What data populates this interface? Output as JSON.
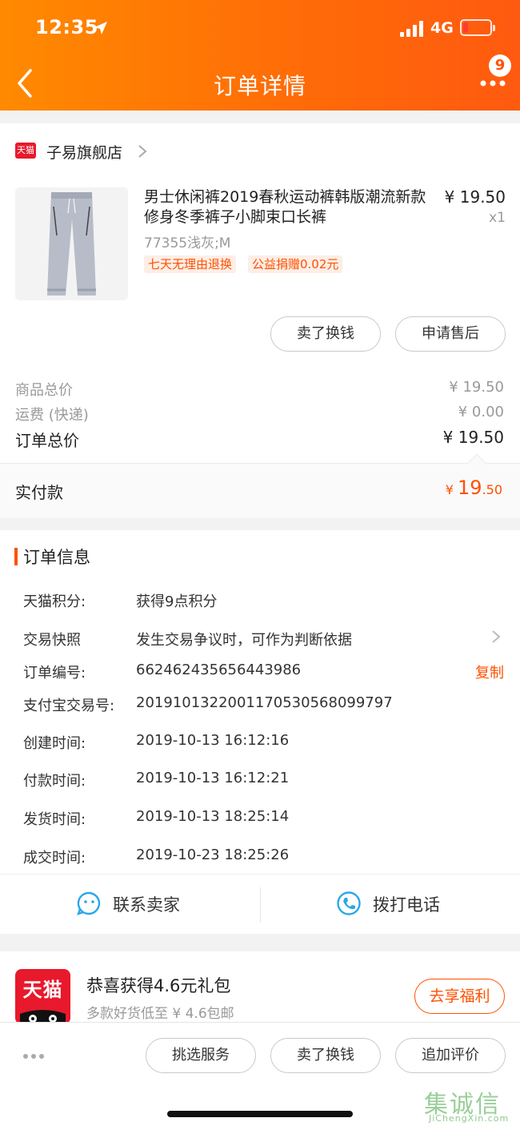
{
  "status_bar": {
    "time": "12:35",
    "network": "4G",
    "battery_color": "#ff3b30"
  },
  "nav": {
    "title": "订单详情",
    "badge": "9"
  },
  "shop": {
    "name": "子易旗舰店",
    "platform_tag": "天猫"
  },
  "product": {
    "title": "男士休闲裤2019春秋运动裤韩版潮流新款修身冬季裤子小脚束口长裤",
    "price": "¥ 19.50",
    "qty": "x1",
    "sku": "77355浅灰;M",
    "tags": [
      "七天无理由退换",
      "公益捐赠0.02元"
    ]
  },
  "item_actions": {
    "sell_exchange": "卖了换钱",
    "after_sale": "申请售后"
  },
  "summary": {
    "goods_total_label": "商品总价",
    "goods_total_value": "¥ 19.50",
    "shipping_label": "运费 (快递)",
    "shipping_value": "¥ 0.00",
    "order_total_label": "订单总价",
    "order_total_value": "¥ 19.50",
    "paid_label": "实付款",
    "paid_currency": "¥",
    "paid_int": "19",
    "paid_dec": ".50"
  },
  "order_info": {
    "section_title": "订单信息",
    "rows": [
      {
        "label": "天猫积分:",
        "value": "获得9点积分"
      },
      {
        "label": "交易快照",
        "value": "发生交易争议时，可作为判断依据"
      },
      {
        "label": "订单编号:",
        "value": "662462435656443986"
      },
      {
        "label": "支付宝交易号:",
        "value": "2019101322001170530568099797"
      },
      {
        "label": "创建时间:",
        "value": "2019-10-13 16:12:16"
      },
      {
        "label": "付款时间:",
        "value": "2019-10-13 16:12:21"
      },
      {
        "label": "发货时间:",
        "value": "2019-10-13 18:25:14"
      },
      {
        "label": "成交时间:",
        "value": "2019-10-23 18:25:26"
      }
    ],
    "copy_label": "复制"
  },
  "contact": {
    "seller": "联系卖家",
    "phone": "拨打电话"
  },
  "promo": {
    "logo_text": "天猫",
    "title": "恭喜获得4.6元礼包",
    "subtitle": "多款好货低至 ¥ 4.6包邮",
    "button": "去享福利"
  },
  "bottom_bar": {
    "buttons": [
      "挑选服务",
      "卖了换钱",
      "追加评价"
    ]
  },
  "watermark": {
    "main": "集诚信",
    "sub": "JiChengXin.com"
  },
  "colors": {
    "accent": "#ff5000",
    "header_start": "#ff8a00",
    "header_end": "#ff5a10",
    "tmall_red": "#e8192c"
  }
}
